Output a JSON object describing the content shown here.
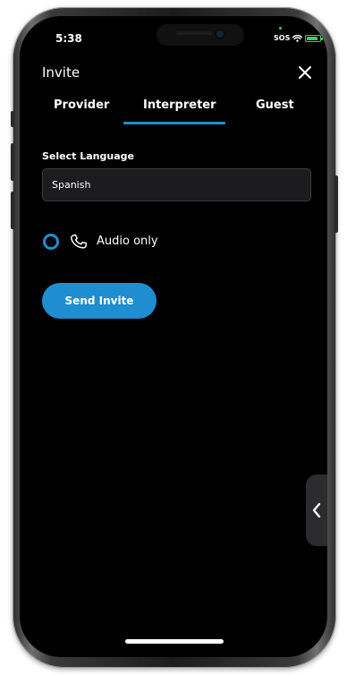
{
  "status_bar": {
    "time": "5:38",
    "carrier": "SOS",
    "battery_level": 0.8,
    "battery_color": "#3bd15a"
  },
  "header": {
    "title": "Invite",
    "close_icon": "close-icon"
  },
  "tabs": [
    {
      "label": "Provider",
      "selected": false
    },
    {
      "label": "Interpreter",
      "selected": true
    },
    {
      "label": "Guest",
      "selected": false
    }
  ],
  "language": {
    "label": "Select Language",
    "value": "Spanish"
  },
  "audio_option": {
    "label": "Audio only",
    "checked": false,
    "icon": "phone-icon"
  },
  "send_button": {
    "label": "Send Invite"
  },
  "colors": {
    "accent": "#1f8ed0",
    "background": "#000000",
    "input_bg": "#1c1c1e"
  }
}
